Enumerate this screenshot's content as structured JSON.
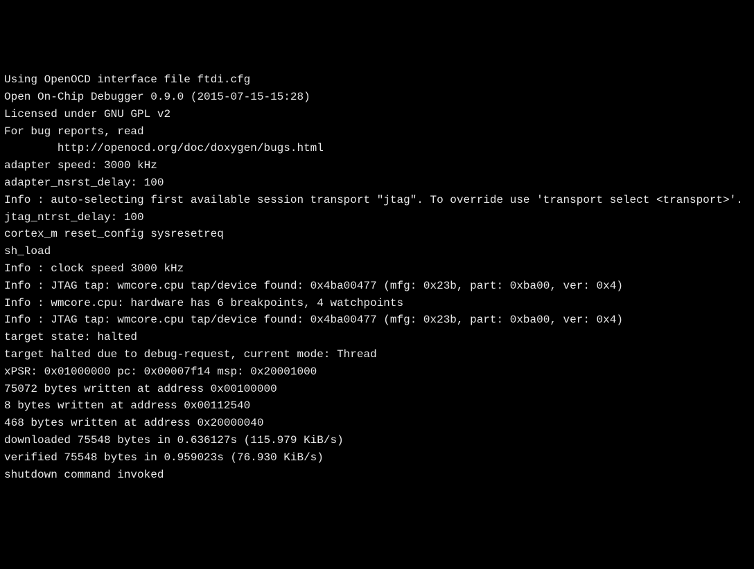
{
  "terminal": {
    "lines": [
      "Using OpenOCD interface file ftdi.cfg",
      "Open On-Chip Debugger 0.9.0 (2015-07-15-15:28)",
      "Licensed under GNU GPL v2",
      "For bug reports, read",
      "http://openocd.org/doc/doxygen/bugs.html",
      "adapter speed: 3000 kHz",
      "adapter_nsrst_delay: 100",
      "Info : auto-selecting first available session transport \"jtag\". To override use 'transport select <transport>'.",
      "jtag_ntrst_delay: 100",
      "cortex_m reset_config sysresetreq",
      "sh_load",
      "Info : clock speed 3000 kHz",
      "Info : JTAG tap: wmcore.cpu tap/device found: 0x4ba00477 (mfg: 0x23b, part: 0xba00, ver: 0x4)",
      "Info : wmcore.cpu: hardware has 6 breakpoints, 4 watchpoints",
      "Info : JTAG tap: wmcore.cpu tap/device found: 0x4ba00477 (mfg: 0x23b, part: 0xba00, ver: 0x4)",
      "target state: halted",
      "target halted due to debug-request, current mode: Thread",
      "xPSR: 0x01000000 pc: 0x00007f14 msp: 0x20001000",
      "75072 bytes written at address 0x00100000",
      "8 bytes written at address 0x00112540",
      "468 bytes written at address 0x20000040",
      "downloaded 75548 bytes in 0.636127s (115.979 KiB/s)",
      "verified 75548 bytes in 0.959023s (76.930 KiB/s)",
      "shutdown command invoked"
    ],
    "indent_indices": [
      4
    ]
  }
}
